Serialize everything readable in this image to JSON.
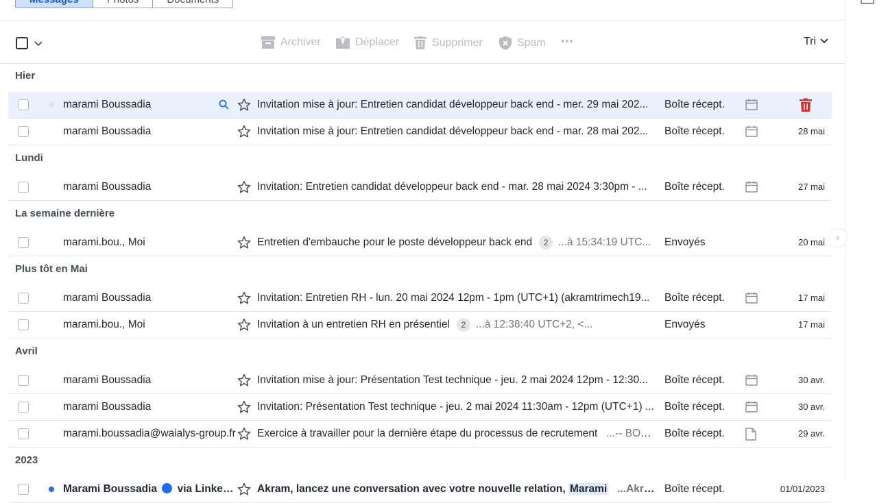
{
  "tabs": [
    {
      "label": "Messages",
      "active": true
    },
    {
      "label": "Photos",
      "active": false
    },
    {
      "label": "Documents",
      "active": false
    }
  ],
  "toolbar": {
    "archive": "Archiver",
    "move": "Déplacer",
    "delete": "Supprimer",
    "spam": "Spam",
    "more": "•••",
    "sort": "Tri"
  },
  "groups": [
    {
      "label": "Hier",
      "rows": [
        {
          "sender": "marami Boussadia",
          "subject": "Invitation mise à jour: Entretien candidat développeur back end - mer. 29 mai 202...",
          "folder": "Boîte récept.",
          "icon": "calendar-icon",
          "date": "",
          "hover": true
        },
        {
          "sender": "marami Boussadia",
          "subject": "Invitation mise à jour: Entretien candidat développeur back end - mar. 28 mai 202...",
          "folder": "Boîte récept.",
          "icon": "calendar-icon",
          "date": "28 mai"
        }
      ]
    },
    {
      "label": "Lundi",
      "rows": [
        {
          "sender": "marami Boussadia",
          "subject": "Invitation: Entretien candidat développeur back end - mar. 28 mai 2024 3:30pm - ...",
          "folder": "Boîte récept.",
          "icon": "calendar-icon",
          "date": "27 mai"
        }
      ]
    },
    {
      "label": "La semaine dernière",
      "rows": [
        {
          "sender": "marami.bou., Moi",
          "subject": "Entretien d'embauche pour le poste développeur back end",
          "count": "2",
          "snippet": "...à 15:34:19 UTC...",
          "folder": "Envoyés",
          "icon": "",
          "date": "20 mai"
        }
      ]
    },
    {
      "label": "Plus tôt en Mai",
      "rows": [
        {
          "sender": "marami Boussadia",
          "subject": "Invitation: Entretien RH - lun. 20 mai 2024 12pm - 1pm (UTC+1) (akramtrimech19...",
          "folder": "Boîte récept.",
          "icon": "calendar-icon",
          "date": "17 mai"
        },
        {
          "sender": "marami.bou., Moi",
          "subject": "Invitation à un entretien RH en présentiel",
          "count": "2",
          "snippet": "...à 12:38:40 UTC+2, <...",
          "folder": "Envoyés",
          "icon": "",
          "date": "17 mai"
        }
      ]
    },
    {
      "label": "Avril",
      "rows": [
        {
          "sender": "marami Boussadia",
          "subject": "Invitation mise à jour: Présentation Test technique - jeu. 2 mai 2024 12pm - 12:30...",
          "folder": "Boîte récept.",
          "icon": "calendar-icon",
          "date": "30 avr."
        },
        {
          "sender": "marami Boussadia",
          "subject": "Invitation: Présentation Test technique - jeu. 2 mai 2024 11:30am - 12pm (UTC+1) ...",
          "folder": "Boîte récept.",
          "icon": "calendar-icon",
          "date": "30 avr."
        },
        {
          "sender": "marami.boussadia@waialys-group.fr",
          "subject": "Exercice à travailler pour la dernière étape du processus de recrutement",
          "snippet": "...-- BOU...",
          "folder": "Boîte récept.",
          "icon": "file-icon",
          "date": "29 avr."
        }
      ]
    },
    {
      "label": "2023",
      "rows": [
        {
          "sender": "Marami Boussadia",
          "sender_via": "via Linked...",
          "subject": "Akram, lancez une conversation avec votre nouvelle relation, ",
          "subject_mark": "Marami",
          "snippet": "...Akra...",
          "folder": "Boîte récept.",
          "icon": "",
          "date": "01/01/2023",
          "unread": true
        }
      ]
    }
  ]
}
